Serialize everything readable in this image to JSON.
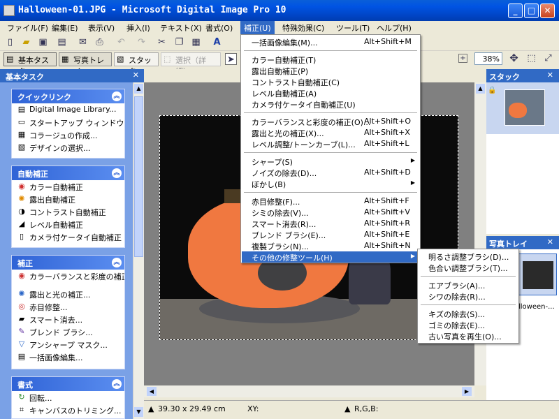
{
  "window": {
    "title": "Halloween-01.JPG - Microsoft Digital Image Pro 10"
  },
  "menubar": [
    "ファイル(F)",
    "編集(E)",
    "表示(V)",
    "挿入(I)",
    "テキスト(X)",
    "書式(O)",
    "補正(U)",
    "特殊効果(C)",
    "ツール(T)",
    "ヘルプ(H)"
  ],
  "toolbar": {
    "zoom": "38%",
    "tabs": [
      "基本タスク",
      "写真トレイ",
      "スタック",
      "選択（詳細）"
    ]
  },
  "left_panel": {
    "title": "基本タスク",
    "groups": [
      {
        "title": "クイックリンク",
        "items": [
          "Digital Image Library...",
          "スタートアップ ウィンドウ...",
          "コラージュの作成...",
          "デザインの選択..."
        ]
      },
      {
        "title": "自動補正",
        "items": [
          "カラー自動補正",
          "露出自動補正",
          "コントラスト自動補正",
          "レベル自動補正",
          "カメラ付ケータイ自動補正"
        ]
      },
      {
        "title": "補正",
        "items": [
          "カラーバランスと彩度の補正...",
          "露出と光の補正...",
          "赤目修整...",
          "スマート消去...",
          "ブレンド ブラシ...",
          "アンシャープ マスク...",
          "一括画像編集..."
        ]
      },
      {
        "title": "書式",
        "items": [
          "回転...",
          "キャンバスのトリミング..."
        ]
      }
    ]
  },
  "correct_menu": {
    "items": [
      {
        "label": "一括画像編集(M)...",
        "shortcut": "Alt+Shift+M"
      },
      {
        "sep": true
      },
      {
        "label": "カラー自動補正(T)",
        "shortcut": ""
      },
      {
        "label": "露出自動補正(P)",
        "shortcut": ""
      },
      {
        "label": "コントラスト自動補正(C)",
        "shortcut": ""
      },
      {
        "label": "レベル自動補正(A)",
        "shortcut": ""
      },
      {
        "label": "カメラ付ケータイ自動補正(U)",
        "shortcut": ""
      },
      {
        "sep": true
      },
      {
        "label": "カラーバランスと彩度の補正(O)...",
        "shortcut": "Alt+Shift+O"
      },
      {
        "label": "露出と光の補正(X)...",
        "shortcut": "Alt+Shift+X"
      },
      {
        "label": "レベル調整/トーンカーブ(L)...",
        "shortcut": "Alt+Shift+L"
      },
      {
        "sep": true
      },
      {
        "label": "シャープ(S)",
        "shortcut": "",
        "submenu": true
      },
      {
        "label": "ノイズの除去(D)...",
        "shortcut": "Alt+Shift+D"
      },
      {
        "label": "ぼかし(B)",
        "shortcut": "",
        "submenu": true
      },
      {
        "sep": true
      },
      {
        "label": "赤目修整(F)...",
        "shortcut": "Alt+Shift+F"
      },
      {
        "label": "シミの除去(V)...",
        "shortcut": "Alt+Shift+V"
      },
      {
        "label": "スマート消去(R)...",
        "shortcut": "Alt+Shift+R"
      },
      {
        "label": "ブレンド ブラシ(E)...",
        "shortcut": "Alt+Shift+E"
      },
      {
        "label": "複製ブラシ(N)...",
        "shortcut": "Alt+Shift+N"
      },
      {
        "label": "その他の修整ツール(H)",
        "shortcut": "",
        "submenu": true,
        "highlight": true
      }
    ]
  },
  "submenu": {
    "items": [
      {
        "label": "明るさ調整ブラシ(D)..."
      },
      {
        "label": "色合い調整ブラシ(T)..."
      },
      {
        "sep": true
      },
      {
        "label": "エアブラシ(A)..."
      },
      {
        "label": "シワの除去(R)..."
      },
      {
        "sep": true
      },
      {
        "label": "キズの除去(S)..."
      },
      {
        "label": "ゴミの除去(E)..."
      },
      {
        "label": "古い写真を再生(O)..."
      }
    ]
  },
  "stack_panel": {
    "title": "スタック"
  },
  "tray_panel": {
    "title": "写真トレイ",
    "thumb_label": "lloween-..."
  },
  "status": {
    "size": "39.30 x 29.49 cm",
    "xy": "XY:",
    "rgb": "R,G,B:"
  },
  "colors": {
    "accent": "#316ac5",
    "titlebar": "#0054e3",
    "pumpkin": "#f08040"
  }
}
